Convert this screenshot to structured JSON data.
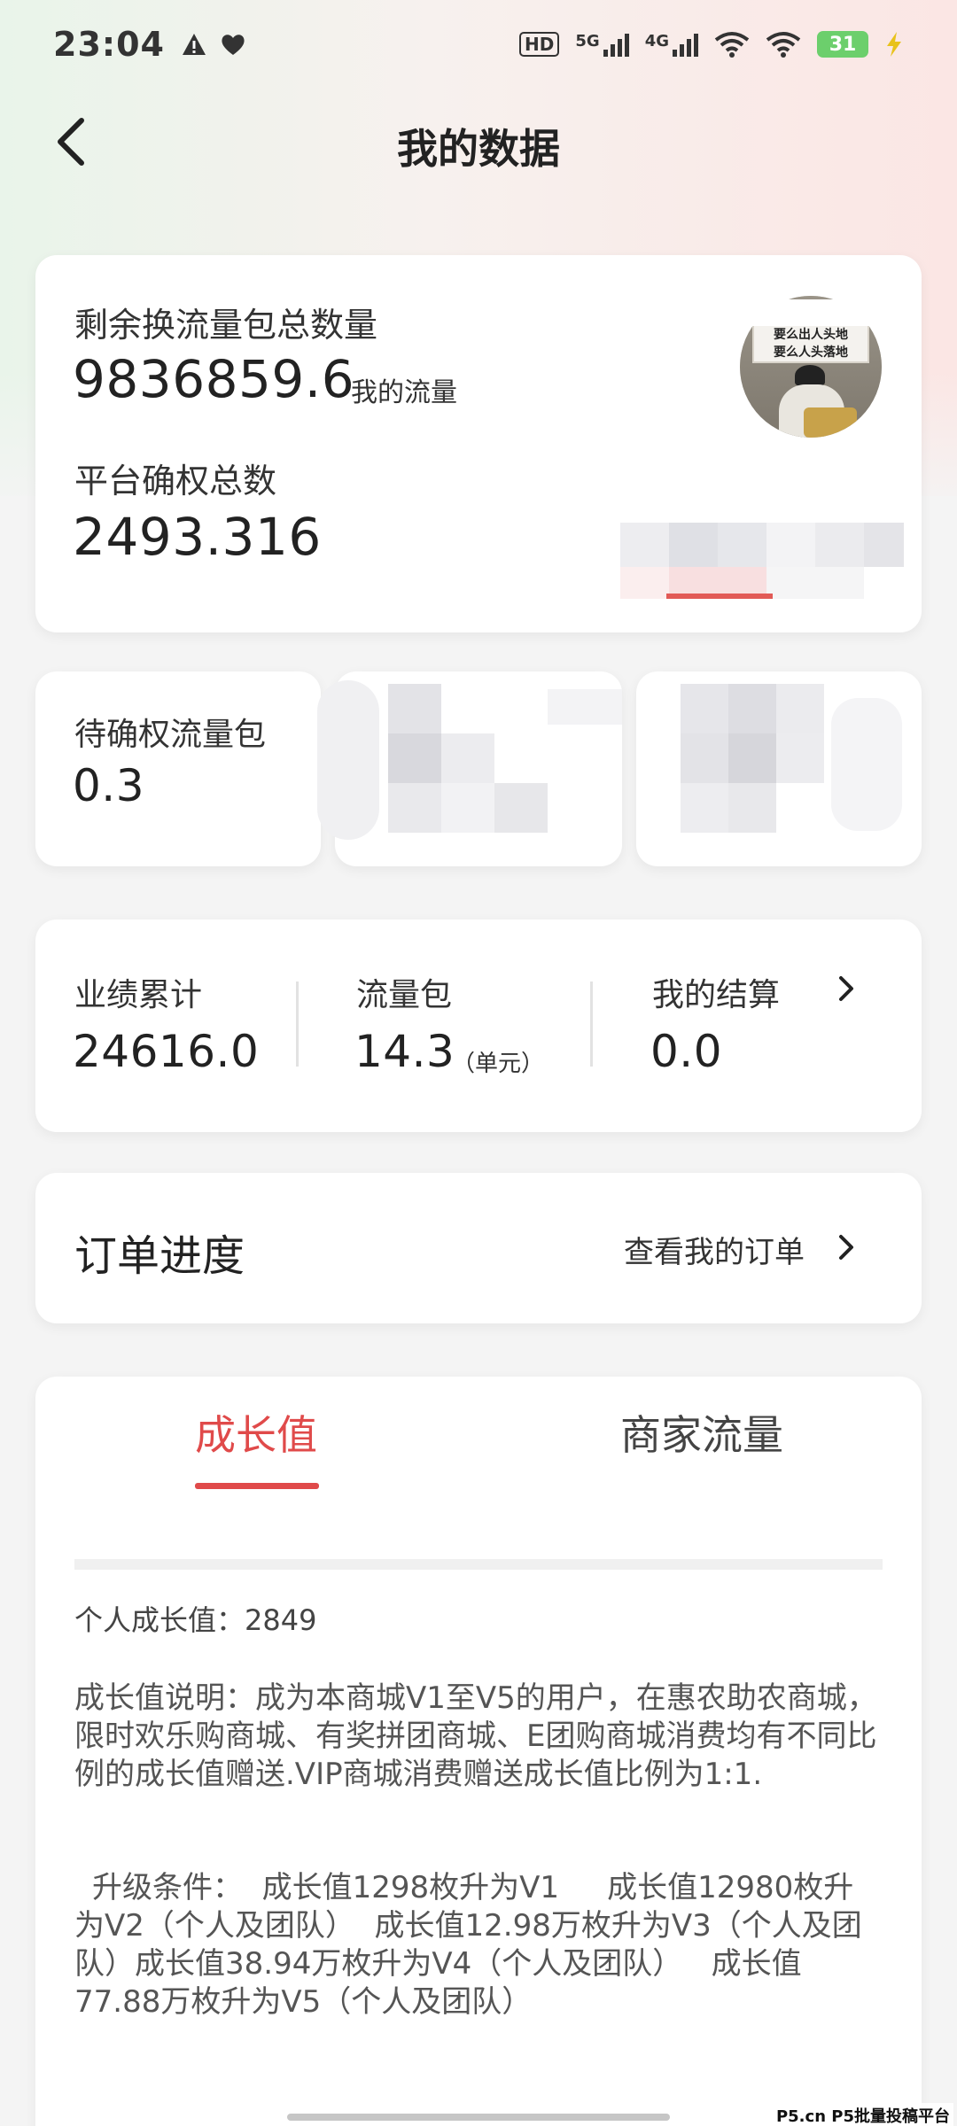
{
  "status_bar": {
    "time": "23:04",
    "left_icons": [
      "warning-icon",
      "heart-icon"
    ],
    "network_labels": [
      "HD",
      "5G",
      "4G"
    ],
    "battery": "31"
  },
  "header": {
    "title": "我的数据"
  },
  "summary": {
    "remaining_label": "剩余换流量包总数量",
    "remaining_value": "9836859.6",
    "my_traffic_label": "我的流量",
    "platform_label": "平台确权总数",
    "platform_value": "2493.316",
    "avatar_banner_lines": [
      "要么出人头地",
      "要么人头落地"
    ]
  },
  "pending": {
    "label": "待确权流量包",
    "value": "0.3"
  },
  "stats": {
    "performance_label": "业绩累计",
    "performance_value": "24616.0",
    "packet_label": "流量包",
    "packet_value": "14.3",
    "packet_unit": "（单元）",
    "settlement_label": "我的结算",
    "settlement_value": "0.0"
  },
  "orders": {
    "title": "订单进度",
    "link_label": "查看我的订单"
  },
  "tabs": {
    "items": [
      {
        "label": "成长值",
        "active": true
      },
      {
        "label": "商家流量",
        "active": false
      }
    ],
    "active_color": "#e04a4a",
    "personal_growth": "个人成长值：2849",
    "description": "成长值说明：成为本商城V1至V5的用户，在惠农助农商城，限时欢乐购商城、有奖拼团商城、E团购商城消费均有不同比例的成长值赠送.VIP商城消费赠送成长值比例为1:1.",
    "upgrade": "升级条件：  成长值1298枚升为V1     成长值12980枚升为V2（个人及团队）  成长值12.98万枚升为V3（个人及团队）成长值38.94万枚升为V4（个人及团队）   成长值77.88万枚升为V5（个人及团队）"
  },
  "watermark": "P5.cn P5批量投稿平台"
}
